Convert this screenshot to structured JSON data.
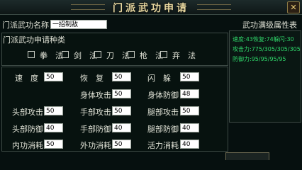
{
  "window": {
    "title": "门派武功申请",
    "close_icon": "close-icon"
  },
  "name_row": {
    "label": "门派武功名称",
    "value": "一招制敌"
  },
  "category": {
    "label": "门派武功申请种类",
    "options": [
      "拳　法",
      "剑　法",
      "刀　法",
      "枪　法",
      "弃　法"
    ]
  },
  "stats": {
    "speed": {
      "label": "速　度",
      "value": "50"
    },
    "recover": {
      "label": "恢　复",
      "value": "50"
    },
    "dodge": {
      "label": "闪　躲",
      "value": "50"
    },
    "body_attack": {
      "label": "身体攻击",
      "value": "50"
    },
    "body_defense": {
      "label": "身体防御",
      "value": "48"
    },
    "head_attack": {
      "label": "头部攻击",
      "value": "50"
    },
    "hand_attack": {
      "label": "手部攻击",
      "value": "50"
    },
    "leg_attack": {
      "label": "腿部攻击",
      "value": "50"
    },
    "head_defense": {
      "label": "头部防御",
      "value": "40"
    },
    "hand_defense": {
      "label": "手部防御",
      "value": "40"
    },
    "leg_defense": {
      "label": "腿部防御",
      "value": "40"
    },
    "inner_cost": {
      "label": "内功消耗",
      "value": "50"
    },
    "outer_cost": {
      "label": "外功消耗",
      "value": "50"
    },
    "vitality_cost": {
      "label": "活力消耗",
      "value": "40"
    }
  },
  "max_attr": {
    "title": "武功满级属性表",
    "lines": [
      "速度:43恢复:74躲闪:30",
      "攻击力:775/305/305/305",
      "防御力:95/95/95/95"
    ],
    "line_color": "#2fd86a"
  }
}
